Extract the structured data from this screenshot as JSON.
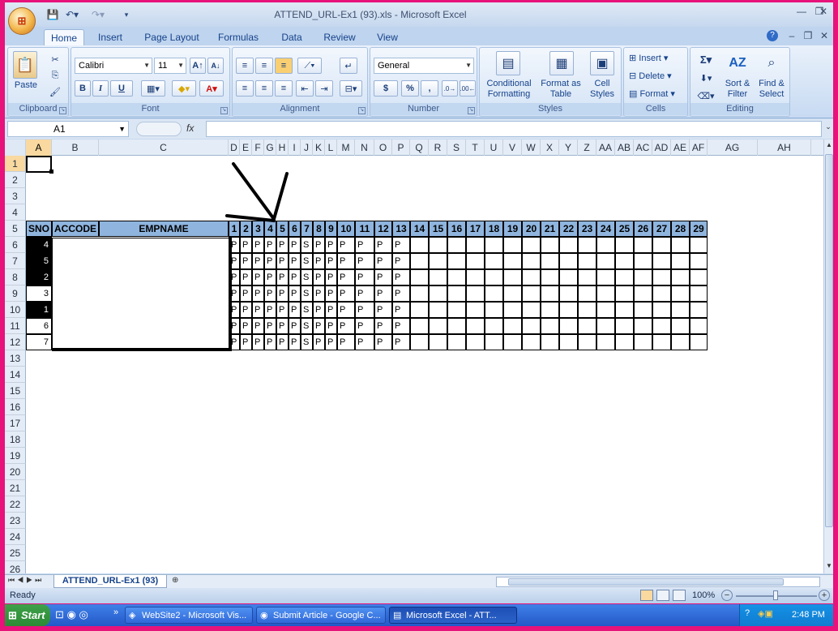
{
  "window": {
    "title": "ATTEND_URL-Ex1 (93).xls - Microsoft Excel"
  },
  "office_button": {
    "glyph": "⊞"
  },
  "ribbon_tabs": [
    "Home",
    "Insert",
    "Page Layout",
    "Formulas",
    "Data",
    "Review",
    "View"
  ],
  "ribbon": {
    "clipboard": {
      "label": "Clipboard",
      "paste": "Paste"
    },
    "font": {
      "label": "Font",
      "name": "Calibri",
      "size": "11",
      "bold": "B",
      "italic": "I",
      "underline": "U"
    },
    "alignment": {
      "label": "Alignment"
    },
    "number": {
      "label": "Number",
      "format": "General",
      "currency": "$",
      "percent": "%",
      "comma": ","
    },
    "styles": {
      "label": "Styles",
      "conditional": "Conditional Formatting",
      "format_table": "Format as Table",
      "cell_styles": "Cell Styles"
    },
    "cells": {
      "label": "Cells",
      "insert": "Insert",
      "delete": "Delete",
      "format": "Format"
    },
    "editing": {
      "label": "Editing",
      "sort": "Sort & Filter",
      "find": "Find & Select"
    }
  },
  "formula_bar": {
    "name_box": "A1",
    "fx": "fx",
    "value": ""
  },
  "columns": [
    "A",
    "B",
    "C",
    "D",
    "E",
    "F",
    "G",
    "H",
    "I",
    "J",
    "K",
    "L",
    "M",
    "N",
    "O",
    "P",
    "Q",
    "R",
    "S",
    "T",
    "U",
    "V",
    "W",
    "X",
    "Y",
    "Z",
    "AA",
    "AB",
    "AC",
    "AD",
    "AE",
    "AF",
    "AG",
    "AH"
  ],
  "rows": [
    "1",
    "2",
    "3",
    "4",
    "5",
    "6",
    "7",
    "8",
    "9",
    "10",
    "11",
    "12",
    "13",
    "14",
    "15",
    "16",
    "17",
    "18",
    "19",
    "20",
    "21",
    "22",
    "23",
    "24",
    "25",
    "26"
  ],
  "table": {
    "headers": [
      "SNO",
      "ACCODE",
      "EMPNAME"
    ],
    "days": [
      "1",
      "2",
      "3",
      "4",
      "5",
      "6",
      "7",
      "8",
      "9",
      "10",
      "11",
      "12",
      "13",
      "14",
      "15",
      "16",
      "17",
      "18",
      "19",
      "20",
      "21",
      "22",
      "23",
      "24",
      "25",
      "26",
      "27",
      "28",
      "29"
    ],
    "sno": [
      "4",
      "5",
      "2",
      "3",
      "1",
      "6",
      "7"
    ],
    "attendance": [
      [
        "P",
        "P",
        "P",
        "P",
        "P",
        "P",
        "S",
        "P",
        "P",
        "P",
        "P",
        "P",
        "P"
      ],
      [
        "P",
        "P",
        "P",
        "P",
        "P",
        "P",
        "S",
        "P",
        "P",
        "P",
        "P",
        "P",
        "P"
      ],
      [
        "P",
        "P",
        "P",
        "P",
        "P",
        "P",
        "S",
        "P",
        "P",
        "P",
        "P",
        "P",
        "P"
      ],
      [
        "P",
        "P",
        "P",
        "P",
        "P",
        "P",
        "S",
        "P",
        "P",
        "P",
        "P",
        "P",
        "P"
      ],
      [
        "P",
        "P",
        "P",
        "P",
        "P",
        "P",
        "S",
        "P",
        "P",
        "P",
        "P",
        "P",
        "P"
      ],
      [
        "P",
        "P",
        "P",
        "P",
        "P",
        "P",
        "S",
        "P",
        "P",
        "P",
        "P",
        "P",
        "P"
      ],
      [
        "P",
        "P",
        "P",
        "P",
        "P",
        "P",
        "S",
        "P",
        "P",
        "P",
        "P",
        "P",
        "P"
      ]
    ]
  },
  "sheet_tab": "ATTEND_URL-Ex1 (93)",
  "status": {
    "ready": "Ready",
    "zoom": "100%"
  },
  "taskbar": {
    "start": "Start",
    "items": [
      "WebSite2 - Microsoft Vis...",
      "Submit Article - Google C...",
      "Microsoft Excel - ATT..."
    ],
    "time": "2:48 PM"
  }
}
